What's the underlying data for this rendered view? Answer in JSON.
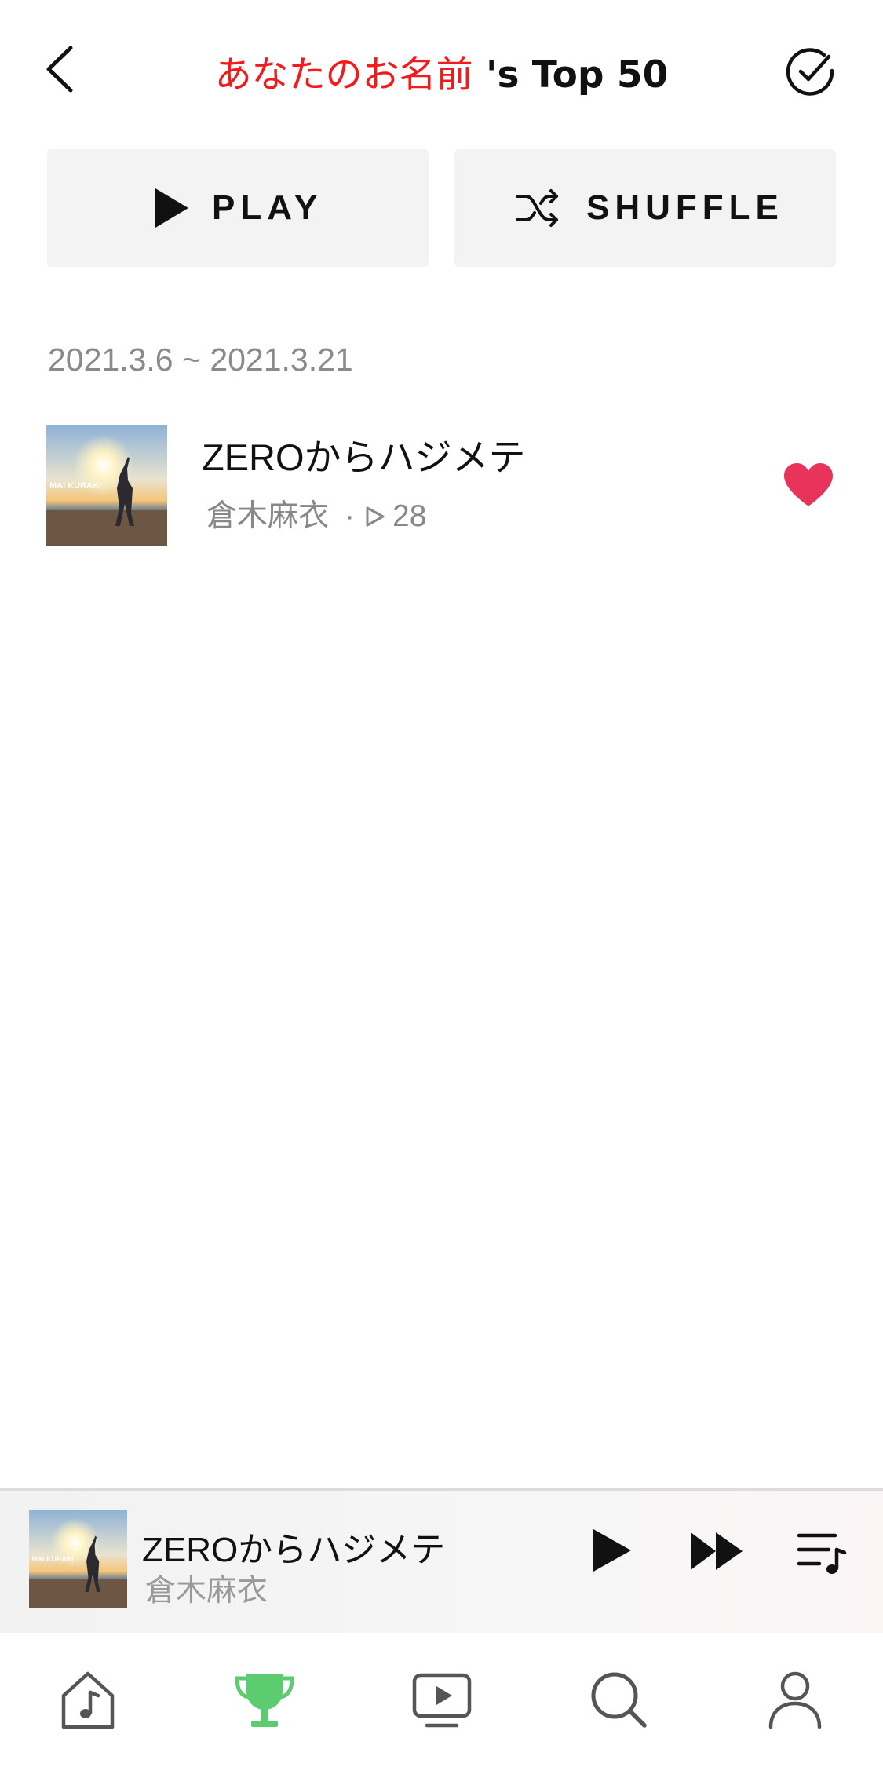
{
  "header": {
    "title_name": "あなたのお名前",
    "title_suffix": " 's Top 50"
  },
  "actions": {
    "play_label": "PLAY",
    "shuffle_label": "SHUFFLE"
  },
  "date_range": "2021.3.6 ~ 2021.3.21",
  "songs": [
    {
      "title": "ZEROからハジメテ",
      "artist": "倉木麻衣",
      "play_count": "28",
      "liked": true
    }
  ],
  "mini_player": {
    "title": "ZEROからハジメテ",
    "artist": "倉木麻衣"
  },
  "bottom_nav": [
    "home-music",
    "chart",
    "video",
    "search",
    "profile"
  ],
  "colors": {
    "accent_red": "#f11b1b",
    "heart": "#e8345a",
    "active_nav": "#5dcc71"
  },
  "album_art_text": "MAI KURAKI"
}
